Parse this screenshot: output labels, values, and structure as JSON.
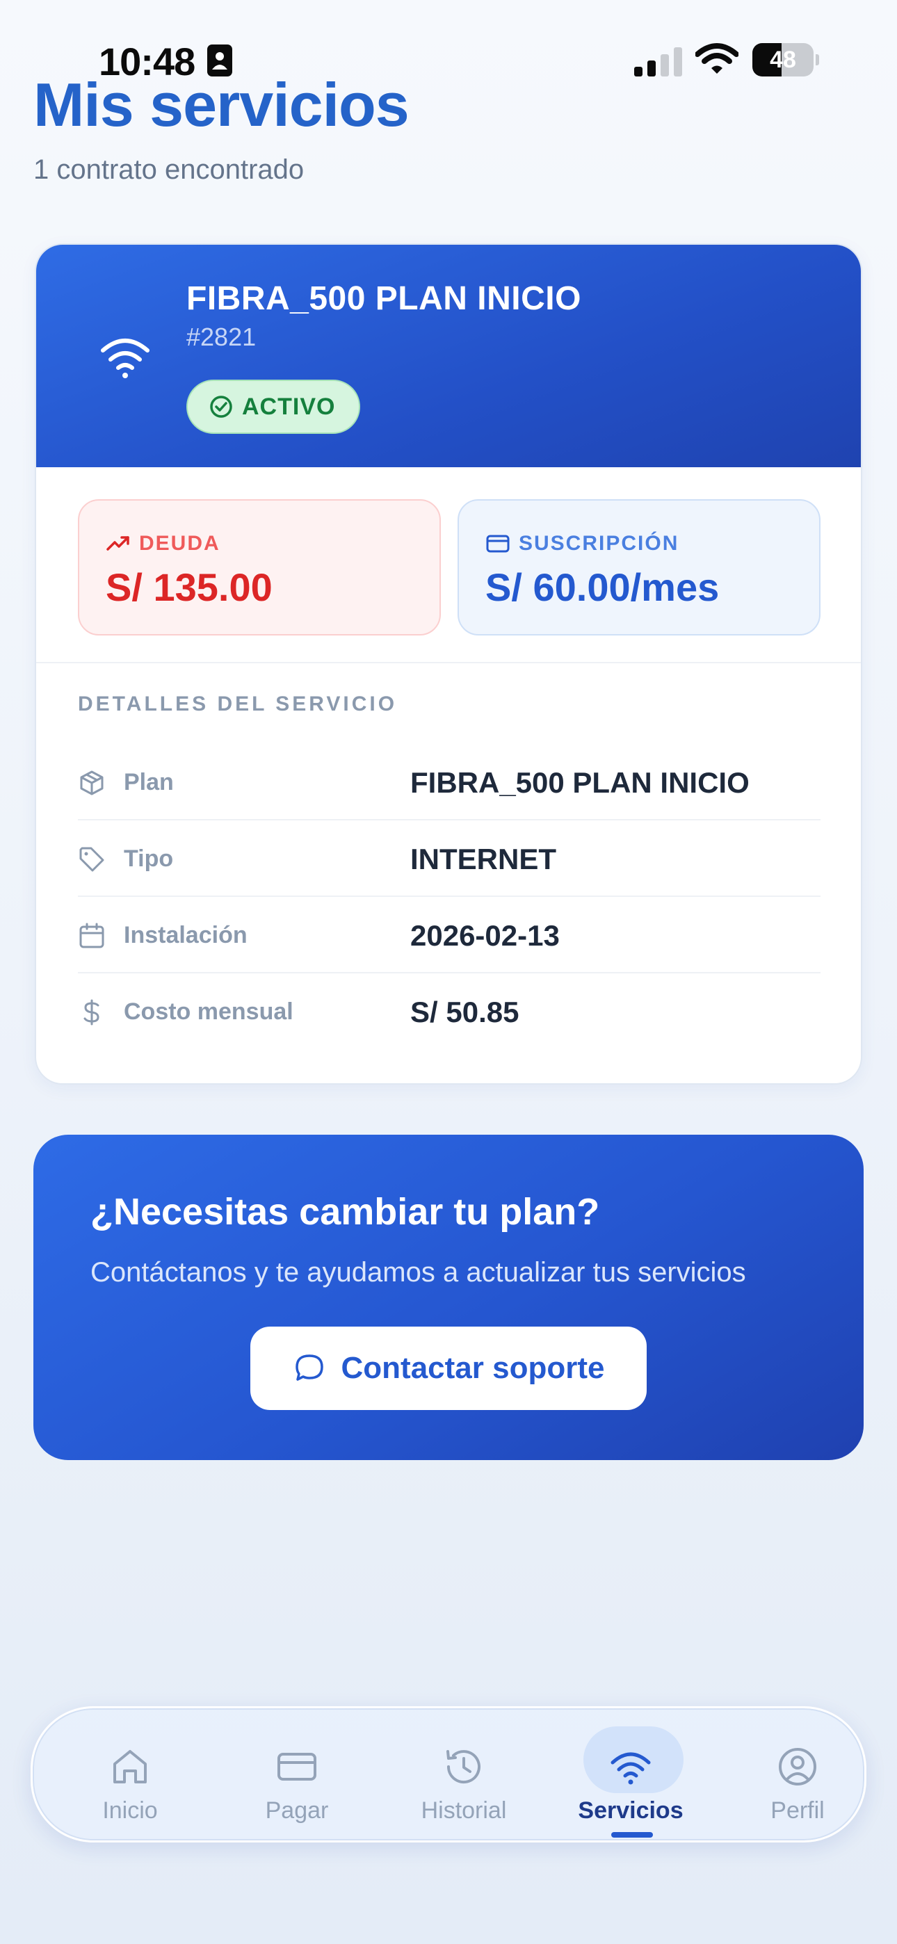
{
  "status_bar": {
    "time": "10:48",
    "battery_level": "48",
    "battery_fraction": 0.48
  },
  "header": {
    "title": "Mis servicios",
    "subtitle": "1 contrato encontrado"
  },
  "service": {
    "plan_name": "FIBRA_500 PLAN INICIO",
    "contract_id": "#2821",
    "status": "ACTIVO",
    "debt": {
      "label": "DEUDA",
      "value": "S/ 135.00",
      "icon": "trending-up-icon"
    },
    "subscription": {
      "label": "SUSCRIPCIÓN",
      "value": "S/ 60.00/mes",
      "icon": "credit-card-icon"
    },
    "details_heading": "DETALLES DEL SERVICIO",
    "details": [
      {
        "label": "Plan",
        "value": "FIBRA_500 PLAN INICIO",
        "icon": "package-icon"
      },
      {
        "label": "Tipo",
        "value": "INTERNET",
        "icon": "tag-icon"
      },
      {
        "label": "Instalación",
        "value": "2026-02-13",
        "icon": "calendar-icon"
      },
      {
        "label": "Costo mensual",
        "value": "S/ 50.85",
        "icon": "dollar-icon"
      }
    ]
  },
  "cta": {
    "title": "¿Necesitas cambiar tu plan?",
    "description": "Contáctanos y te ayudamos a actualizar tus servicios",
    "button_label": "Contactar soporte"
  },
  "nav": {
    "items": [
      {
        "label": "Inicio",
        "icon": "home-icon"
      },
      {
        "label": "Pagar",
        "icon": "credit-card-icon"
      },
      {
        "label": "Historial",
        "icon": "history-icon"
      },
      {
        "label": "Servicios",
        "icon": "wifi-icon",
        "active": true
      },
      {
        "label": "Perfil",
        "icon": "user-circle-icon"
      }
    ]
  },
  "colors": {
    "primary": "#2563c9",
    "card_gradient_start": "#2f6ce5",
    "card_gradient_end": "#1f43b0",
    "status_active": "#15803d",
    "debt": "#dc2626"
  }
}
